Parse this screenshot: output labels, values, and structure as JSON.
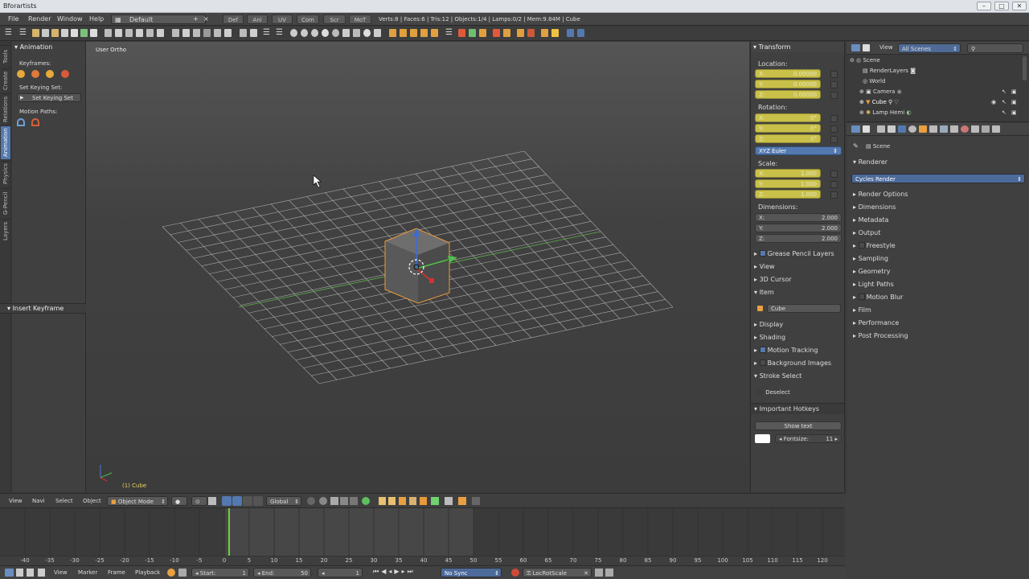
{
  "app": {
    "title": "Bforartists",
    "win_min": "–",
    "win_max": "□",
    "win_close": "✕"
  },
  "menus": [
    "File",
    "Render",
    "Window",
    "Help"
  ],
  "layout_name": "Default",
  "screen_tabs": [
    "Def",
    "Ani",
    "UV",
    "Com",
    "Scr",
    "MoT"
  ],
  "stats": "Verts:8 | Faces:6 | Tris:12 | Objects:1/4 | Lamps:0/2 | Mem:9.84M | Cube",
  "side_tabs": [
    "Tools",
    "Create",
    "Relations",
    "Animation",
    "Physics",
    "G-Pencil",
    "Layers"
  ],
  "left_panel": {
    "title": "Animation",
    "keyframes_label": "Keyframes:",
    "keying_set_label": "Set Keying Set:",
    "keying_set_button": "Set Keying Set",
    "motion_paths_label": "Motion Paths:",
    "insert_keyframe": "Insert Keyframe"
  },
  "viewport": {
    "view_label": "User Ortho",
    "object_label": "(1) Cube"
  },
  "transform": {
    "title": "Transform",
    "location_label": "Location:",
    "location": {
      "x": "0.00000",
      "y": "0.00000",
      "z": "0.00000"
    },
    "rotation_label": "Rotation:",
    "rotation": {
      "x": "0°",
      "y": "0°",
      "z": "0°"
    },
    "rotation_mode": "XYZ Euler",
    "scale_label": "Scale:",
    "scale": {
      "x": "1.000",
      "y": "1.000",
      "z": "1.000"
    },
    "dimensions_label": "Dimensions:",
    "dimensions": {
      "x": "2.000",
      "y": "2.000",
      "z": "2.000"
    },
    "axis_x": "X:",
    "axis_y": "Y:",
    "axis_z": "Z:"
  },
  "right_sections": {
    "grease_pencil": "Grease Pencil Layers",
    "view": "View",
    "cursor": "3D Cursor",
    "item": "Item",
    "item_name": "Cube",
    "display": "Display",
    "shading": "Shading",
    "motion_tracking": "Motion Tracking",
    "background_images": "Background Images",
    "stroke_select": "Stroke Select",
    "deselect": "Deselect",
    "hotkeys": "Important Hotkeys",
    "show_text": "Show text",
    "fontsize_label": "Fontsize:",
    "fontsize": "11"
  },
  "outliner": {
    "view_menu": "View",
    "scenes": "All Scenes",
    "items": [
      "Scene",
      "RenderLayers",
      "World",
      "Camera",
      "Cube",
      "Lamp Hemi"
    ]
  },
  "properties": {
    "context": "Scene",
    "renderer_section": "Renderer",
    "renderer": "Cycles Render",
    "panels": [
      "Render Options",
      "Dimensions",
      "Metadata",
      "Output",
      "Freestyle",
      "Sampling",
      "Geometry",
      "Light Paths",
      "Motion Blur",
      "Film",
      "Performance",
      "Post Processing"
    ]
  },
  "view3d_header": {
    "menus": [
      "View",
      "Navi",
      "Select",
      "Object"
    ],
    "mode": "Object Mode",
    "orientation": "Global"
  },
  "ruler": [
    "-40",
    "-35",
    "-30",
    "-25",
    "-20",
    "-15",
    "-10",
    "-5",
    "0",
    "5",
    "10",
    "15",
    "20",
    "25",
    "30",
    "35",
    "40",
    "45",
    "50",
    "55",
    "60",
    "65",
    "70",
    "75",
    "80",
    "85",
    "90",
    "95",
    "100",
    "105",
    "110",
    "115",
    "120"
  ],
  "timeline_footer": {
    "menus": [
      "View",
      "Marker",
      "Frame",
      "Playback"
    ],
    "start_label": "Start:",
    "start": "1",
    "end_label": "End:",
    "end": "50",
    "current": "1",
    "sync": "No Sync",
    "keying": "LocRotScale"
  },
  "colors": {
    "accent": "#5479b0",
    "yellow": "#c9c04a",
    "selection": "#e8a030",
    "playhead": "#6fd13b"
  }
}
